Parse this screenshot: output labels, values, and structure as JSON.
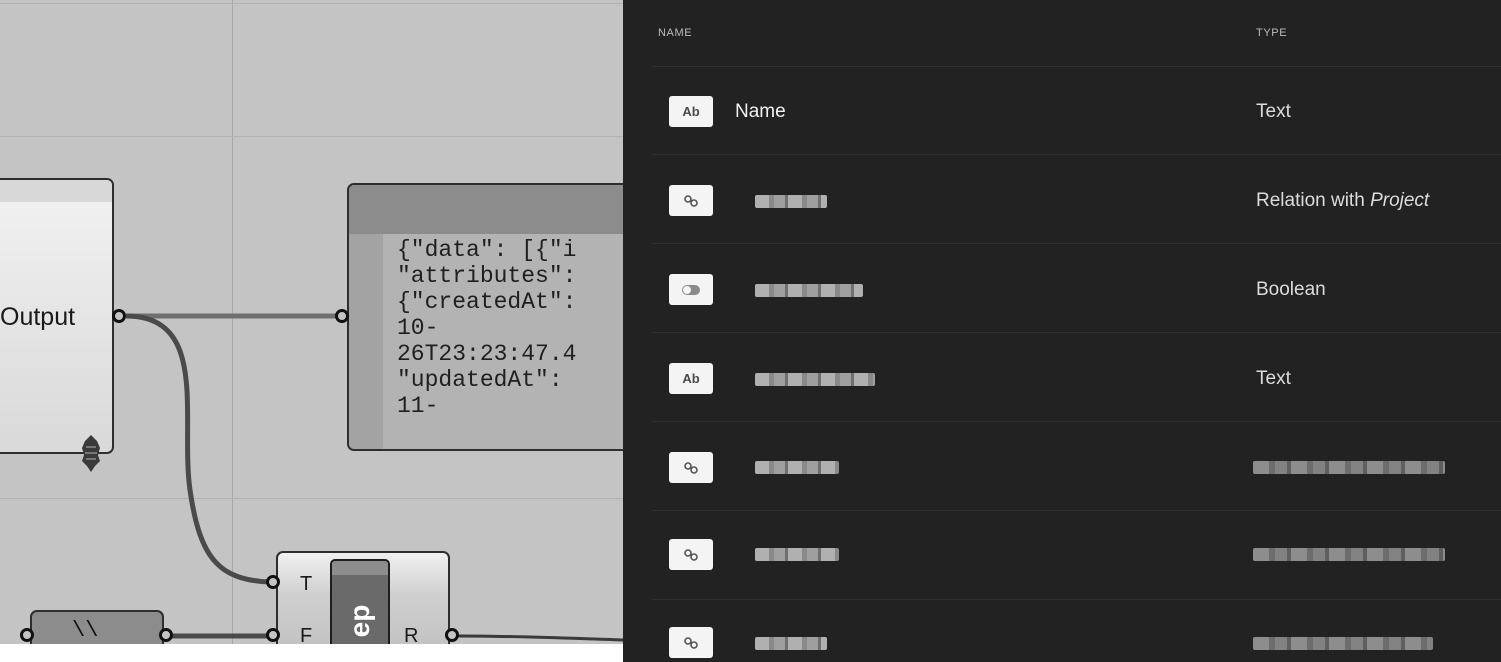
{
  "canvas": {
    "output_node": {
      "label": "Output"
    },
    "panel_node": {
      "content": "{\"data\": [{\"i\n\"attributes\":\n{\"createdAt\":\n10-\n26T23:23:47.4\n\"updatedAt\":\n11-"
    },
    "switch_node": {
      "title": "ep",
      "input_t": "T",
      "input_f": "F",
      "output_r": "R"
    },
    "backslash_node": {
      "text": "\\\\"
    }
  },
  "table": {
    "columns": {
      "name": "NAME",
      "type": "TYPE"
    },
    "rows": [
      {
        "icon": "text-icon",
        "badge": "Ab",
        "name": "Name",
        "type_prefix": "Text",
        "type_emph": ""
      },
      {
        "icon": "relation-icon",
        "badge": "",
        "name": "",
        "type_prefix": "Relation with ",
        "type_emph": "Project"
      },
      {
        "icon": "toggle-icon",
        "badge": "",
        "name": "",
        "type_prefix": "Boolean",
        "type_emph": ""
      },
      {
        "icon": "text-icon",
        "badge": "Ab",
        "name": "",
        "type_prefix": "Text",
        "type_emph": ""
      },
      {
        "icon": "relation-icon",
        "badge": "",
        "name": "",
        "type_prefix": "",
        "type_emph": ""
      },
      {
        "icon": "relation-icon",
        "badge": "",
        "name": "",
        "type_prefix": "",
        "type_emph": ""
      },
      {
        "icon": "relation-icon",
        "badge": "",
        "name": "",
        "type_prefix": "",
        "type_emph": ""
      }
    ]
  }
}
